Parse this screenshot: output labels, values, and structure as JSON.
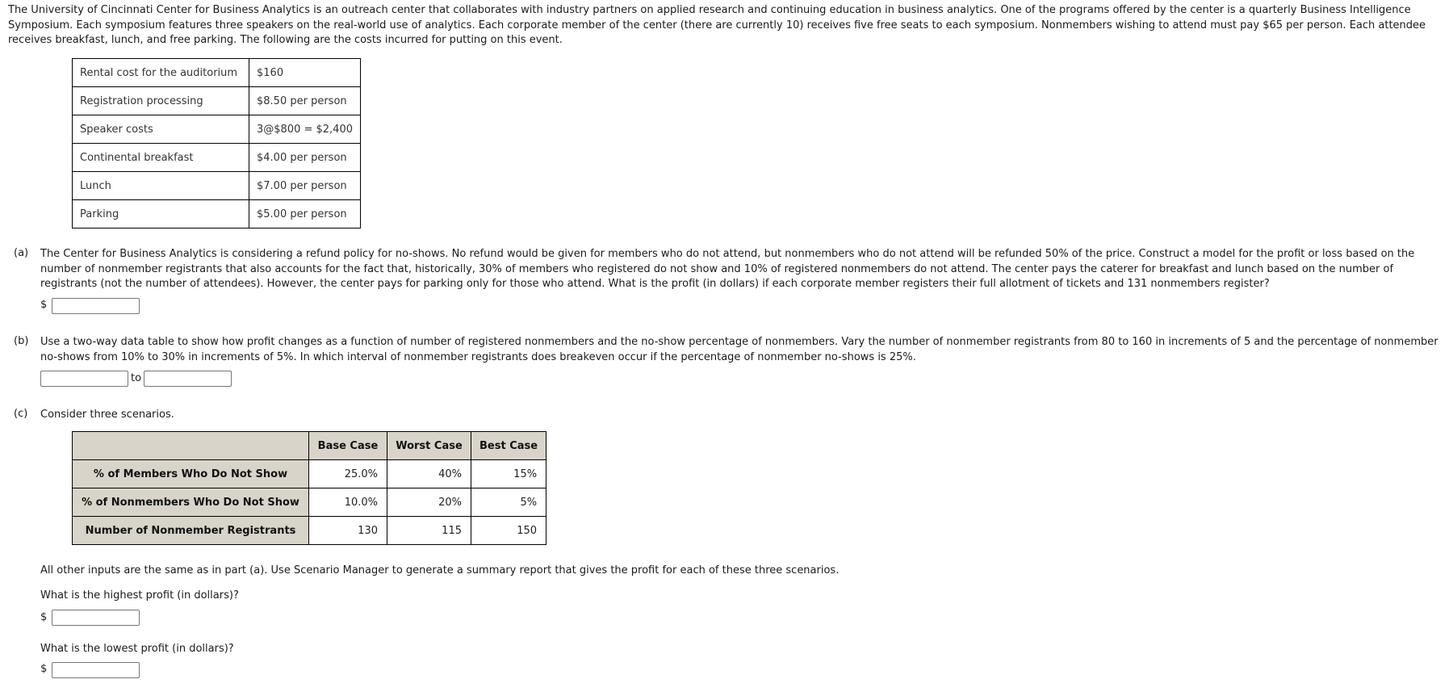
{
  "intro": "The University of Cincinnati Center for Business Analytics is an outreach center that collaborates with industry partners on applied research and continuing education in business analytics. One of the programs offered by the center is a quarterly Business Intelligence Symposium. Each symposium features three speakers on the real-world use of analytics. Each corporate member of the center (there are currently 10) receives five free seats to each symposium. Nonmembers wishing to attend must pay $65 per person. Each attendee receives breakfast, lunch, and free parking. The following are the costs incurred for putting on this event.",
  "costs": [
    {
      "label": "Rental cost for the auditorium",
      "value": "$160"
    },
    {
      "label": "Registration processing",
      "value": "$8.50 per person"
    },
    {
      "label": "Speaker costs",
      "value": "3@$800 = $2,400"
    },
    {
      "label": "Continental breakfast",
      "value": "$4.00 per person"
    },
    {
      "label": "Lunch",
      "value": "$7.00 per person"
    },
    {
      "label": "Parking",
      "value": "$5.00 per person"
    }
  ],
  "part_a": {
    "tag": "(a)",
    "text": "The Center for Business Analytics is considering a refund policy for no-shows. No refund would be given for members who do not attend, but nonmembers who do not attend will be refunded 50% of the price. Construct a model for the profit or loss based on the number of nonmember registrants that also accounts for the fact that, historically, 30% of members who registered do not show and 10% of registered nonmembers do not attend. The center pays the caterer for breakfast and lunch based on the number of registrants (not the number of attendees). However, the center pays for parking only for those who attend. What is the profit (in dollars) if each corporate member registers their full allotment of tickets and 131 nonmembers register?",
    "currency": "$",
    "answer": ""
  },
  "part_b": {
    "tag": "(b)",
    "text": "Use a two-way data table to show how profit changes as a function of number of registered nonmembers and the no-show percentage of nonmembers. Vary the number of nonmember registrants from 80 to 160 in increments of 5 and the percentage of nonmember no-shows from 10% to 30% in increments of 5%. In which interval of nonmember registrants does breakeven occur if the percentage of nonmember no-shows is 25%.",
    "answer_from": "",
    "to_label": "to",
    "answer_to": ""
  },
  "part_c": {
    "tag": "(c)",
    "text": "Consider three scenarios.",
    "table": {
      "headers": [
        "",
        "Base Case",
        "Worst Case",
        "Best Case"
      ],
      "rows": [
        {
          "label": "% of Members Who Do Not Show",
          "values": [
            "25.0%",
            "40%",
            "15%"
          ]
        },
        {
          "label": "% of Nonmembers Who Do Not Show",
          "values": [
            "10.0%",
            "20%",
            "5%"
          ]
        },
        {
          "label": "Number of Nonmember Registrants",
          "values": [
            "130",
            "115",
            "150"
          ]
        }
      ]
    },
    "note": "All other inputs are the same as in part (a). Use Scenario Manager to generate a summary report that gives the profit for each of these three scenarios.",
    "q_high": "What is the highest profit (in dollars)?",
    "q_low": "What is the lowest profit (in dollars)?",
    "currency": "$",
    "answer_high": "",
    "answer_low": ""
  }
}
